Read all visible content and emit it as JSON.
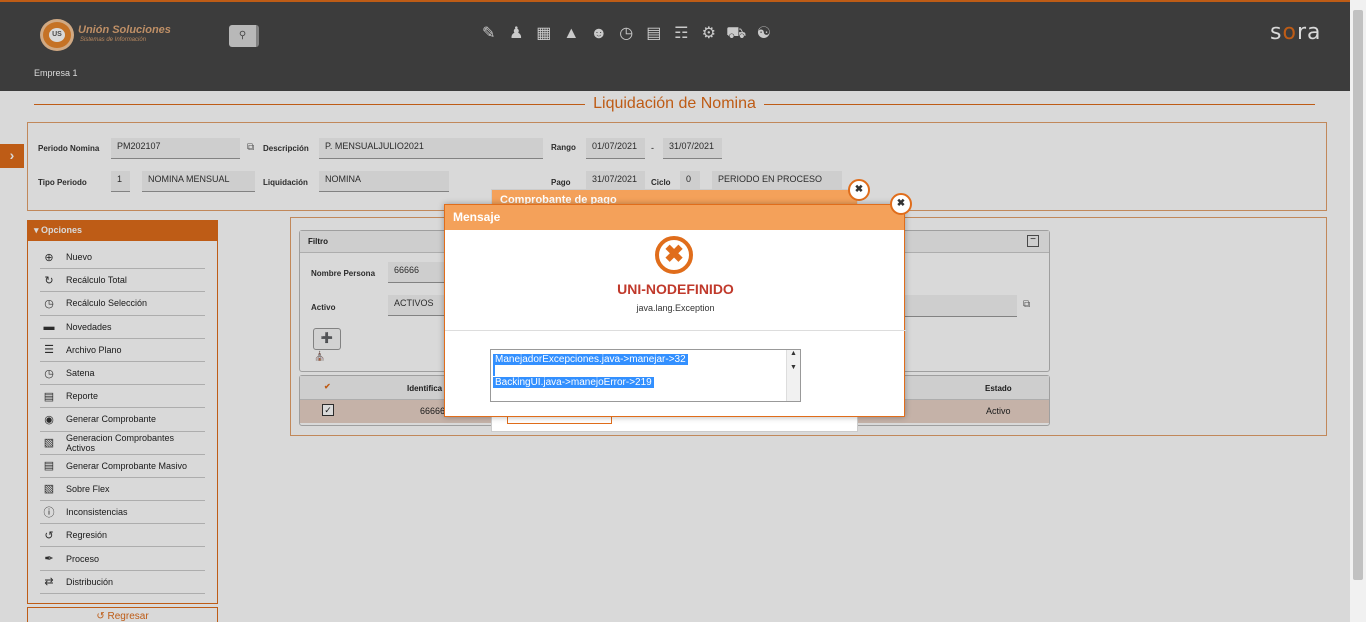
{
  "header": {
    "brand": "Unión Soluciones",
    "brand_sub": "Sistemas de Información",
    "logo_text": "US",
    "empresa": "Empresa 1",
    "sora_prefix": "s",
    "sora_o": "o",
    "sora_suffix": "ra",
    "search_icon": "search-icon",
    "icons": [
      "payroll-icon",
      "person-money-icon",
      "gift-icon",
      "org-chart-icon",
      "team-icon",
      "stopwatch-icon",
      "document-icon",
      "board-icon",
      "settings-cogs-icon",
      "car-shield-icon",
      "group-icon"
    ],
    "accent": "#e06d1b"
  },
  "page": {
    "title": "Liquidación de Nomina"
  },
  "periodo": {
    "periodo_label": "Periodo Nomina",
    "periodo_value": "PM202107",
    "descripcion_label": "Descripción",
    "descripcion_value": "P. MENSUALJULIO2021",
    "rango_label": "Rango",
    "rango_desde": "01/07/2021",
    "rango_sep": "-",
    "rango_hasta": "31/07/2021",
    "tipo_label": "Tipo Periodo",
    "tipo_code": "1",
    "tipo_value": "NOMINA MENSUAL",
    "liquidacion_label": "Liquidación",
    "liquidacion_value": "NOMINA",
    "pago_label": "Pago",
    "pago_value": "31/07/2021",
    "ciclo_label": "Ciclo",
    "ciclo_value": "0",
    "estado_value": "PERIODO EN PROCESO"
  },
  "opciones": {
    "title": "Opciones",
    "items": [
      {
        "label": "Nuevo",
        "icon": "plus-circle-icon"
      },
      {
        "label": "Recálculo Total",
        "icon": "refresh-icon"
      },
      {
        "label": "Recálculo Selección",
        "icon": "clock-icon"
      },
      {
        "label": "Novedades",
        "icon": "comment-icon"
      },
      {
        "label": "Archivo Plano",
        "icon": "lines-icon"
      },
      {
        "label": "Satena",
        "icon": "clock-icon"
      },
      {
        "label": "Reporte",
        "icon": "list-icon"
      },
      {
        "label": "Generar Comprobante",
        "icon": "eye-icon"
      },
      {
        "label": "Generacion Comprobantes Activos",
        "icon": "file-gear-icon"
      },
      {
        "label": "Generar Comprobante Masivo",
        "icon": "list-icon"
      },
      {
        "label": "Sobre Flex",
        "icon": "file-gear-icon"
      },
      {
        "label": "Inconsistencias",
        "icon": "exclamation-icon"
      },
      {
        "label": "Regresión",
        "icon": "undo-icon"
      },
      {
        "label": "Proceso",
        "icon": "paperclip-icon"
      },
      {
        "label": "Distribución",
        "icon": "transfer-icon"
      }
    ],
    "regresar": "Regresar"
  },
  "filtro": {
    "title": "Filtro",
    "nombre_label": "Nombre Persona",
    "nombre_value": "66666",
    "activo_label": "Activo",
    "activo_value": "ACTIVOS"
  },
  "grid": {
    "check_header": "✔",
    "id_header": "Identifica",
    "estado_header": "Estado",
    "row_id": "66666",
    "row_estado": "Activo"
  },
  "dialog_back": {
    "title": "Comprobante de pago"
  },
  "dialog": {
    "title": "Mensaje",
    "error_title": "UNI-NODEFINIDO",
    "error_sub": "java.lang.Exception",
    "lines": [
      "ManejadorExcepciones.java->manejar->32",
      "BackingUI.java->manejoError->219"
    ]
  }
}
